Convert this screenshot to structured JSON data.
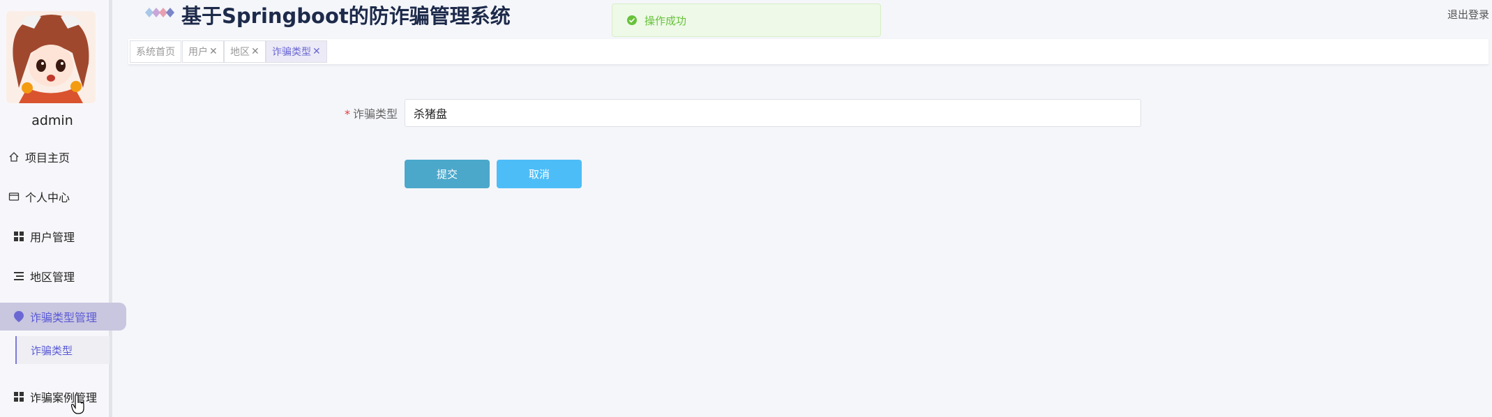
{
  "header": {
    "title": "基于Springboot的防诈骗管理系统",
    "logout_label": "退出登录"
  },
  "toast": {
    "message": "操作成功",
    "icon": "success-check-icon"
  },
  "sidebar": {
    "username": "admin",
    "items": [
      {
        "label": "项目主页",
        "icon": "home-icon"
      },
      {
        "label": "个人中心",
        "icon": "wallet-icon"
      },
      {
        "label": "用户管理",
        "icon": "grid-icon"
      },
      {
        "label": "地区管理",
        "icon": "list-icon"
      },
      {
        "label": "诈骗类型管理",
        "icon": "location-pin-icon",
        "active": true
      },
      {
        "label": "诈骗案例管理",
        "icon": "grid-icon"
      }
    ],
    "submenu": {
      "label": "诈骗类型"
    }
  },
  "tabs": [
    {
      "label": "系统首页",
      "closable": false
    },
    {
      "label": "用户",
      "closable": true
    },
    {
      "label": "地区",
      "closable": true
    },
    {
      "label": "诈骗类型",
      "closable": true,
      "active": true
    }
  ],
  "tab_close_glyph": "✕",
  "form": {
    "field_label": "诈骗类型",
    "required_mark": "*",
    "field_value": "杀猪盘",
    "submit_label": "提交",
    "cancel_label": "取消"
  },
  "colors": {
    "accent": "#5b5bd6",
    "submit": "#4ba8cb",
    "cancel": "#4dbdf7",
    "toast_text": "#67c23a"
  }
}
